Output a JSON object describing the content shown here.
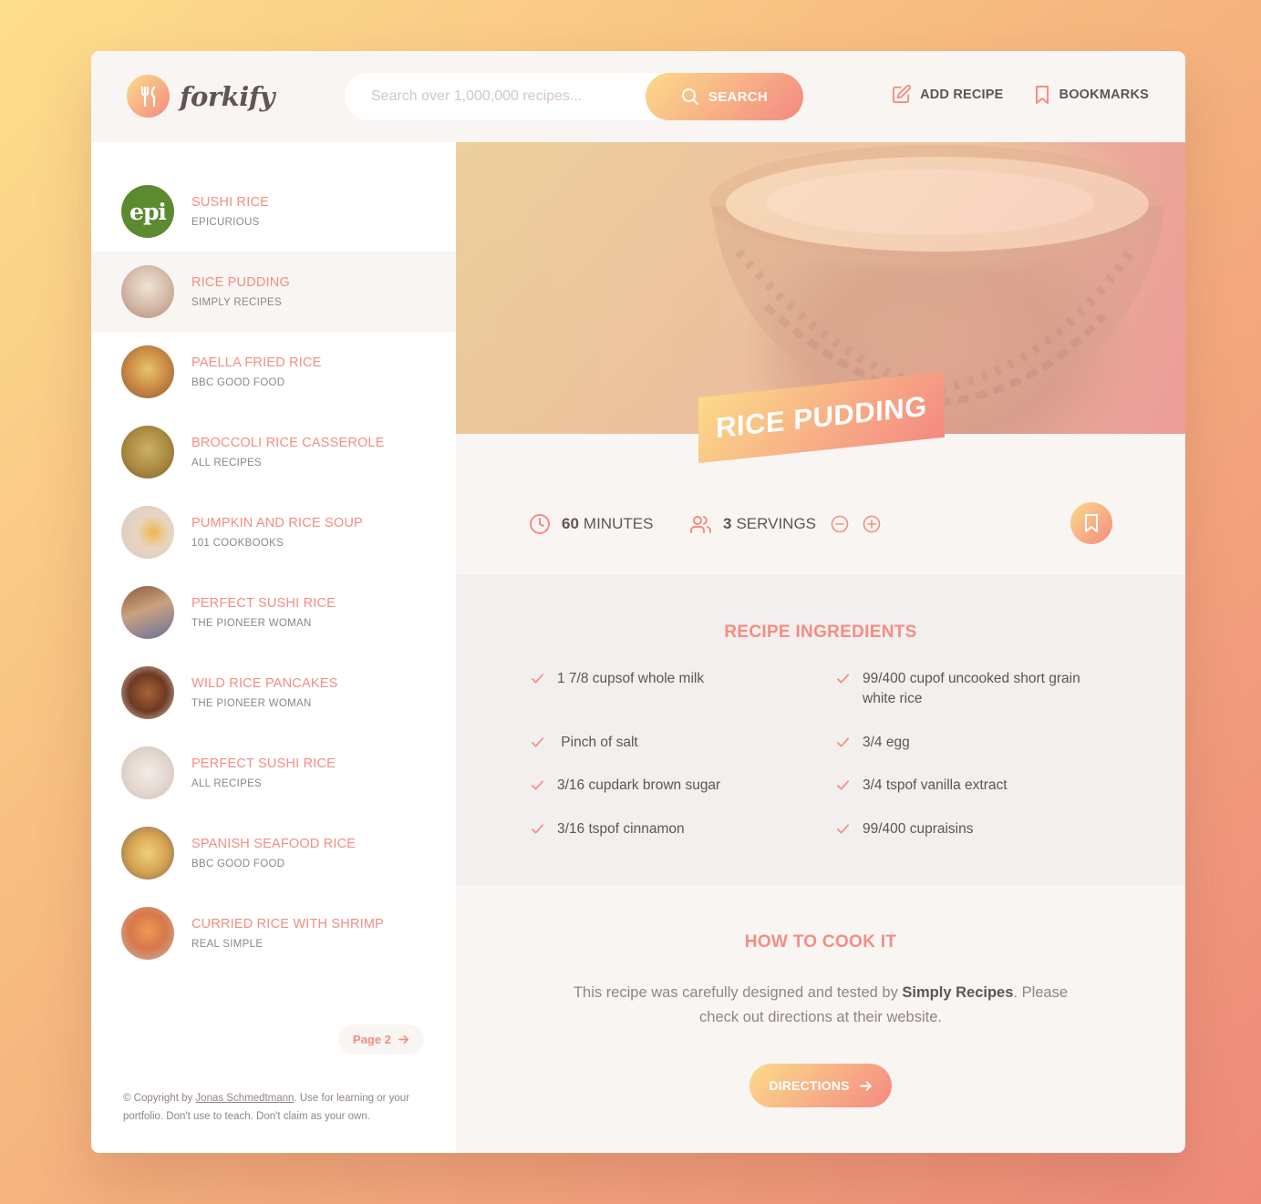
{
  "app": {
    "name": "forkify"
  },
  "search": {
    "placeholder": "Search over 1,000,000 recipes...",
    "button_label": "SEARCH"
  },
  "nav": {
    "add_recipe": "ADD RECIPE",
    "bookmarks": "BOOKMARKS"
  },
  "results": [
    {
      "title": "SUSHI RICE",
      "publisher": "EPICURIOUS",
      "thumb": "epi-logo",
      "active": false
    },
    {
      "title": "RICE PUDDING",
      "publisher": "SIMPLY RECIPES",
      "thumb": "rice-pudding",
      "active": true
    },
    {
      "title": "PAELLA FRIED RICE",
      "publisher": "BBC GOOD FOOD",
      "thumb": "paella",
      "active": false
    },
    {
      "title": "BROCCOLI RICE CASSEROLE",
      "publisher": "ALL RECIPES",
      "thumb": "casserole",
      "active": false
    },
    {
      "title": "PUMPKIN AND RICE SOUP",
      "publisher": "101 COOKBOOKS",
      "thumb": "soup",
      "active": false
    },
    {
      "title": "PERFECT SUSHI RICE",
      "publisher": "THE PIONEER WOMAN",
      "thumb": "sushi-rice",
      "active": false
    },
    {
      "title": "WILD RICE PANCAKES",
      "publisher": "THE PIONEER WOMAN",
      "thumb": "pancakes",
      "active": false
    },
    {
      "title": "PERFECT SUSHI RICE",
      "publisher": "ALL RECIPES",
      "thumb": "white-rice",
      "active": false
    },
    {
      "title": "SPANISH SEAFOOD RICE",
      "publisher": "BBC GOOD FOOD",
      "thumb": "seafood",
      "active": false
    },
    {
      "title": "CURRIED RICE WITH SHRIMP",
      "publisher": "REAL SIMPLE",
      "thumb": "shrimp",
      "active": false
    }
  ],
  "epi_label": "epi",
  "pagination": {
    "next_label": "Page 2"
  },
  "copyright": {
    "prefix": "© Copyright by ",
    "author": "Jonas Schmedtmann",
    "suffix": ". Use for learning or your portfolio. Don't use to teach. Don't claim as your own."
  },
  "recipe": {
    "title": "RICE PUDDING",
    "minutes": "60",
    "minutes_label": "MINUTES",
    "servings": "3",
    "servings_label": "SERVINGS",
    "ingredients_heading": "RECIPE INGREDIENTS",
    "ingredients": [
      "1 7/8 cupsof whole milk",
      "99/400 cupof uncooked short grain white rice",
      " Pinch of salt",
      "3/4 egg",
      "3/16 cupdark brown sugar",
      "3/4 tspof vanilla extract",
      "3/16 tspof cinnamon",
      "99/400 cupraisins"
    ],
    "directions_heading": "HOW TO COOK IT",
    "directions_prefix": "This recipe was carefully designed and tested by ",
    "directions_publisher": "Simply Recipes",
    "directions_suffix": ". Please check out directions at their website.",
    "directions_button": "DIRECTIONS"
  },
  "colors": {
    "accent": "#f38e82",
    "gradient_start": "#fbdb89",
    "gradient_end": "#f48982",
    "text": "#615551"
  }
}
